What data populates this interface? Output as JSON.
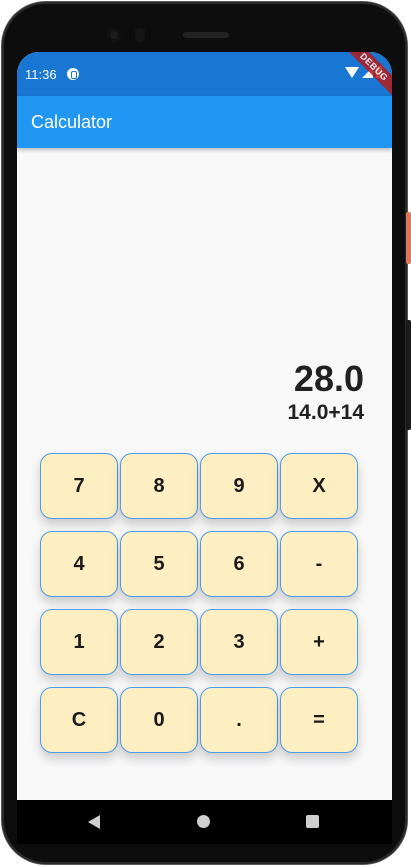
{
  "status_bar": {
    "time": "11:36",
    "debug_label": "DEBUG",
    "icons": [
      "app-notification-icon",
      "wifi-icon",
      "signal-icon",
      "battery-icon"
    ]
  },
  "app_bar": {
    "title": "Calculator",
    "color": "#2196f3"
  },
  "display": {
    "result": "28.0",
    "expression": "14.0+14"
  },
  "keypad": {
    "key_color": "#fdefc2",
    "border_color": "#4a9be8",
    "rows": [
      [
        "7",
        "8",
        "9",
        "X"
      ],
      [
        "4",
        "5",
        "6",
        "-"
      ],
      [
        "1",
        "2",
        "3",
        "+"
      ],
      [
        "C",
        "0",
        ".",
        "="
      ]
    ]
  },
  "nav_bar": {
    "icons": [
      "back-icon",
      "home-icon",
      "recents-icon"
    ]
  }
}
